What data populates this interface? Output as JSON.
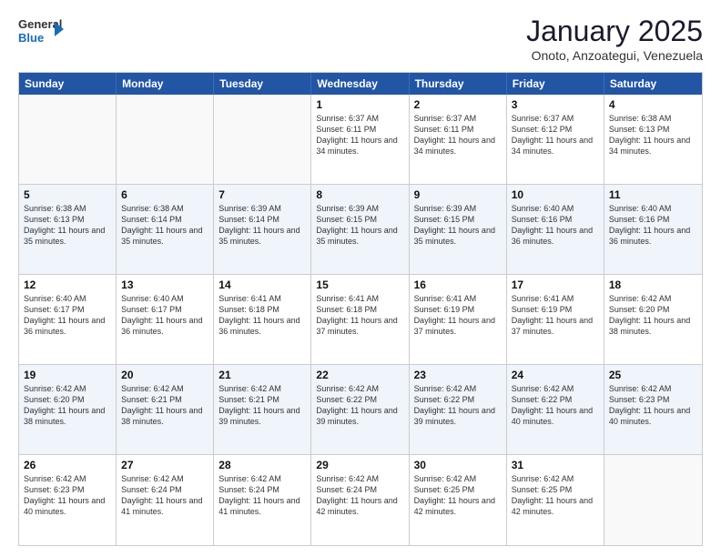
{
  "logo": {
    "general": "General",
    "blue": "Blue"
  },
  "title": "January 2025",
  "subtitle": "Onoto, Anzoategui, Venezuela",
  "days_of_week": [
    "Sunday",
    "Monday",
    "Tuesday",
    "Wednesday",
    "Thursday",
    "Friday",
    "Saturday"
  ],
  "weeks": [
    [
      {
        "day": "",
        "sunrise": "",
        "sunset": "",
        "daylight": ""
      },
      {
        "day": "",
        "sunrise": "",
        "sunset": "",
        "daylight": ""
      },
      {
        "day": "",
        "sunrise": "",
        "sunset": "",
        "daylight": ""
      },
      {
        "day": "1",
        "sunrise": "Sunrise: 6:37 AM",
        "sunset": "Sunset: 6:11 PM",
        "daylight": "Daylight: 11 hours and 34 minutes."
      },
      {
        "day": "2",
        "sunrise": "Sunrise: 6:37 AM",
        "sunset": "Sunset: 6:11 PM",
        "daylight": "Daylight: 11 hours and 34 minutes."
      },
      {
        "day": "3",
        "sunrise": "Sunrise: 6:37 AM",
        "sunset": "Sunset: 6:12 PM",
        "daylight": "Daylight: 11 hours and 34 minutes."
      },
      {
        "day": "4",
        "sunrise": "Sunrise: 6:38 AM",
        "sunset": "Sunset: 6:13 PM",
        "daylight": "Daylight: 11 hours and 34 minutes."
      }
    ],
    [
      {
        "day": "5",
        "sunrise": "Sunrise: 6:38 AM",
        "sunset": "Sunset: 6:13 PM",
        "daylight": "Daylight: 11 hours and 35 minutes."
      },
      {
        "day": "6",
        "sunrise": "Sunrise: 6:38 AM",
        "sunset": "Sunset: 6:14 PM",
        "daylight": "Daylight: 11 hours and 35 minutes."
      },
      {
        "day": "7",
        "sunrise": "Sunrise: 6:39 AM",
        "sunset": "Sunset: 6:14 PM",
        "daylight": "Daylight: 11 hours and 35 minutes."
      },
      {
        "day": "8",
        "sunrise": "Sunrise: 6:39 AM",
        "sunset": "Sunset: 6:15 PM",
        "daylight": "Daylight: 11 hours and 35 minutes."
      },
      {
        "day": "9",
        "sunrise": "Sunrise: 6:39 AM",
        "sunset": "Sunset: 6:15 PM",
        "daylight": "Daylight: 11 hours and 35 minutes."
      },
      {
        "day": "10",
        "sunrise": "Sunrise: 6:40 AM",
        "sunset": "Sunset: 6:16 PM",
        "daylight": "Daylight: 11 hours and 36 minutes."
      },
      {
        "day": "11",
        "sunrise": "Sunrise: 6:40 AM",
        "sunset": "Sunset: 6:16 PM",
        "daylight": "Daylight: 11 hours and 36 minutes."
      }
    ],
    [
      {
        "day": "12",
        "sunrise": "Sunrise: 6:40 AM",
        "sunset": "Sunset: 6:17 PM",
        "daylight": "Daylight: 11 hours and 36 minutes."
      },
      {
        "day": "13",
        "sunrise": "Sunrise: 6:40 AM",
        "sunset": "Sunset: 6:17 PM",
        "daylight": "Daylight: 11 hours and 36 minutes."
      },
      {
        "day": "14",
        "sunrise": "Sunrise: 6:41 AM",
        "sunset": "Sunset: 6:18 PM",
        "daylight": "Daylight: 11 hours and 36 minutes."
      },
      {
        "day": "15",
        "sunrise": "Sunrise: 6:41 AM",
        "sunset": "Sunset: 6:18 PM",
        "daylight": "Daylight: 11 hours and 37 minutes."
      },
      {
        "day": "16",
        "sunrise": "Sunrise: 6:41 AM",
        "sunset": "Sunset: 6:19 PM",
        "daylight": "Daylight: 11 hours and 37 minutes."
      },
      {
        "day": "17",
        "sunrise": "Sunrise: 6:41 AM",
        "sunset": "Sunset: 6:19 PM",
        "daylight": "Daylight: 11 hours and 37 minutes."
      },
      {
        "day": "18",
        "sunrise": "Sunrise: 6:42 AM",
        "sunset": "Sunset: 6:20 PM",
        "daylight": "Daylight: 11 hours and 38 minutes."
      }
    ],
    [
      {
        "day": "19",
        "sunrise": "Sunrise: 6:42 AM",
        "sunset": "Sunset: 6:20 PM",
        "daylight": "Daylight: 11 hours and 38 minutes."
      },
      {
        "day": "20",
        "sunrise": "Sunrise: 6:42 AM",
        "sunset": "Sunset: 6:21 PM",
        "daylight": "Daylight: 11 hours and 38 minutes."
      },
      {
        "day": "21",
        "sunrise": "Sunrise: 6:42 AM",
        "sunset": "Sunset: 6:21 PM",
        "daylight": "Daylight: 11 hours and 39 minutes."
      },
      {
        "day": "22",
        "sunrise": "Sunrise: 6:42 AM",
        "sunset": "Sunset: 6:22 PM",
        "daylight": "Daylight: 11 hours and 39 minutes."
      },
      {
        "day": "23",
        "sunrise": "Sunrise: 6:42 AM",
        "sunset": "Sunset: 6:22 PM",
        "daylight": "Daylight: 11 hours and 39 minutes."
      },
      {
        "day": "24",
        "sunrise": "Sunrise: 6:42 AM",
        "sunset": "Sunset: 6:22 PM",
        "daylight": "Daylight: 11 hours and 40 minutes."
      },
      {
        "day": "25",
        "sunrise": "Sunrise: 6:42 AM",
        "sunset": "Sunset: 6:23 PM",
        "daylight": "Daylight: 11 hours and 40 minutes."
      }
    ],
    [
      {
        "day": "26",
        "sunrise": "Sunrise: 6:42 AM",
        "sunset": "Sunset: 6:23 PM",
        "daylight": "Daylight: 11 hours and 40 minutes."
      },
      {
        "day": "27",
        "sunrise": "Sunrise: 6:42 AM",
        "sunset": "Sunset: 6:24 PM",
        "daylight": "Daylight: 11 hours and 41 minutes."
      },
      {
        "day": "28",
        "sunrise": "Sunrise: 6:42 AM",
        "sunset": "Sunset: 6:24 PM",
        "daylight": "Daylight: 11 hours and 41 minutes."
      },
      {
        "day": "29",
        "sunrise": "Sunrise: 6:42 AM",
        "sunset": "Sunset: 6:24 PM",
        "daylight": "Daylight: 11 hours and 42 minutes."
      },
      {
        "day": "30",
        "sunrise": "Sunrise: 6:42 AM",
        "sunset": "Sunset: 6:25 PM",
        "daylight": "Daylight: 11 hours and 42 minutes."
      },
      {
        "day": "31",
        "sunrise": "Sunrise: 6:42 AM",
        "sunset": "Sunset: 6:25 PM",
        "daylight": "Daylight: 11 hours and 42 minutes."
      },
      {
        "day": "",
        "sunrise": "",
        "sunset": "",
        "daylight": ""
      }
    ]
  ]
}
